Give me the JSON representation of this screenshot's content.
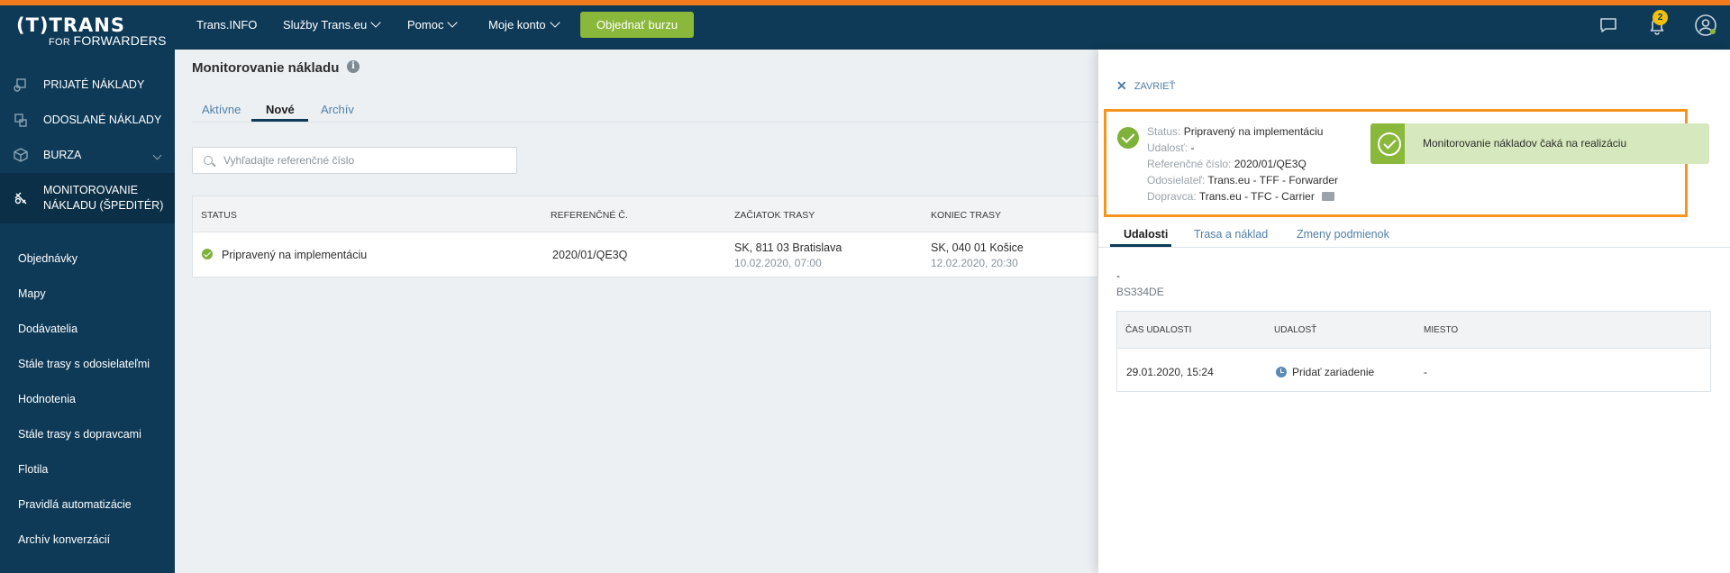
{
  "brand": {
    "logo_main": "(T)TRANS",
    "logo_for": "FOR",
    "logo_sub": "FORWARDERS"
  },
  "colors": {
    "top_bar": "#0e3a57",
    "accent_orange": "#f07a1e",
    "green": "#8ab83a",
    "badge": "#f2c00c",
    "link": "#4f7fa8"
  },
  "topnav": {
    "items": [
      {
        "label": "Trans.INFO"
      },
      {
        "label": "Služby Trans.eu"
      },
      {
        "label": "Pomoc"
      },
      {
        "label": "Moje konto"
      }
    ],
    "order_button": "Objednať burzu",
    "notifications_count": "2",
    "icons": [
      "chat-icon",
      "bell-icon",
      "user-icon"
    ]
  },
  "sidebar": {
    "main_items": [
      {
        "label": "PRIJATÉ NÁKLADY",
        "icon": "boxes-in-icon"
      },
      {
        "label": "ODOSLANÉ NÁKLADY",
        "icon": "boxes-out-icon"
      },
      {
        "label": "BURZA",
        "icon": "cube-icon"
      },
      {
        "label": "MONITOROVANIE",
        "label2": "NÁKLADU (ŠPEDITÉR)",
        "icon": "satellite-icon"
      }
    ],
    "sub_items": [
      {
        "label": "Objednávky"
      },
      {
        "label": "Mapy"
      },
      {
        "label": "Dodávatelia"
      },
      {
        "label": "Stále trasy s odosielateľmi"
      },
      {
        "label": "Hodnotenia"
      },
      {
        "label": "Stále trasy s dopravcami"
      },
      {
        "label": "Flotila"
      },
      {
        "label": "Pravidlá automatizácie"
      },
      {
        "label": "Archív konverzácií"
      }
    ]
  },
  "main": {
    "title": "Monitorovanie nákladu",
    "tabs": [
      {
        "label": "Aktívne"
      },
      {
        "label": "Nové"
      },
      {
        "label": "Archív"
      }
    ],
    "search": {
      "placeholder": "Vyhľadajte referenčné číslo",
      "value": ""
    },
    "table": {
      "headers": [
        "STATUS",
        "REFERENČNÉ Č.",
        "ZAČIATOK TRASY",
        "KONIEC TRASY"
      ],
      "rows": [
        {
          "status": "Pripravený na implementáciu",
          "reference": "2020/01/QE3Q",
          "start_place": "SK, 811 03 Bratislava",
          "start_time": "10.02.2020, 07:00",
          "end_place": "SK, 040 01 Košice",
          "end_time": "12.02.2020, 20:30"
        }
      ]
    }
  },
  "panel": {
    "close_label": "ZAVRIEŤ",
    "status": {
      "status_key": "Status:",
      "status_val": "Pripravený na implementáciu",
      "event_key": "Udalosť:",
      "event_val": "-",
      "ref_key": "Referenčné číslo:",
      "ref_val": "2020/01/QE3Q",
      "sender_key": "Odosielateľ:",
      "sender_val": "Trans.eu - TFF - Forwarder",
      "carrier_key": "Dopravca:",
      "carrier_val": "Trans.eu - TFC - Carrier"
    },
    "banner": "Monitorovanie nákladov čaká na realizáciu",
    "tabs": [
      {
        "label": "Udalosti"
      },
      {
        "label": "Trasa a náklad"
      },
      {
        "label": "Zmeny podmienok"
      }
    ],
    "dash": "-",
    "plate": "BS334DE",
    "events": {
      "headers": [
        "ČAS UDALOSTI",
        "UDALOSŤ",
        "MIESTO"
      ],
      "rows": [
        {
          "time": "29.01.2020, 15:24",
          "event": "Pridať zariadenie",
          "place": "-"
        }
      ]
    }
  }
}
